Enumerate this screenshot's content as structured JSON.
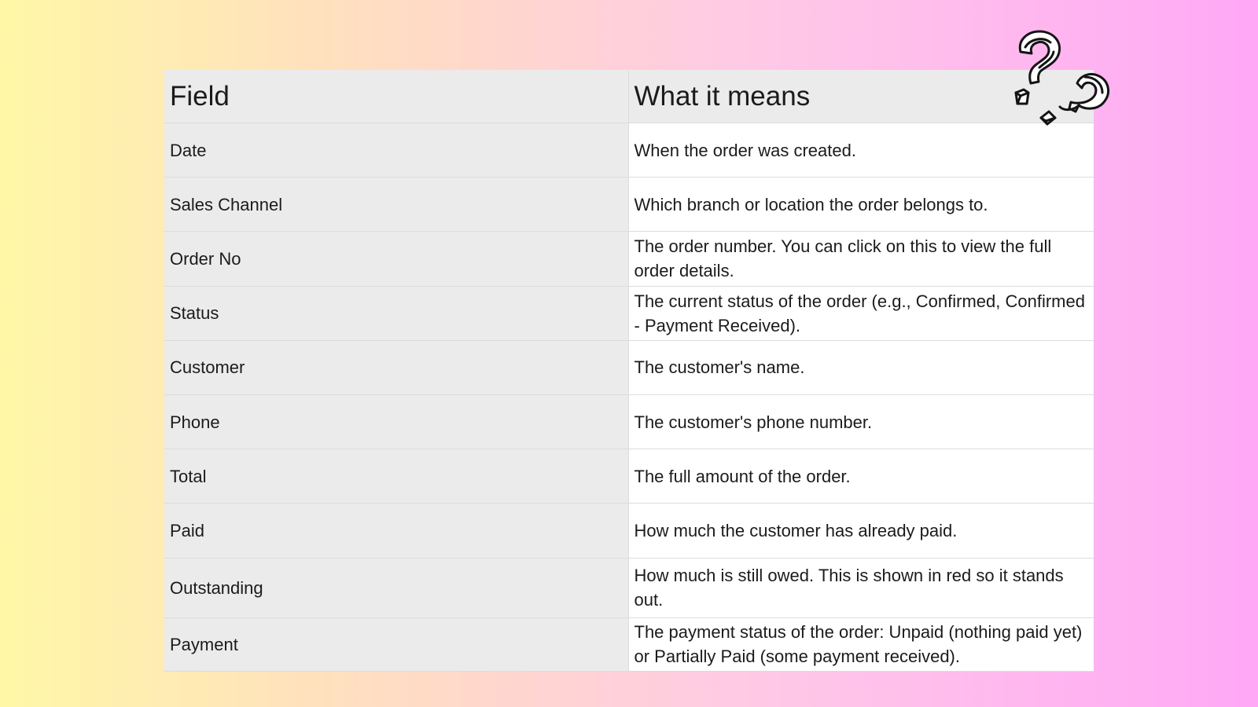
{
  "table": {
    "headers": {
      "field": "Field",
      "meaning": "What it means"
    },
    "rows": [
      {
        "field": "Date",
        "meaning": "When the order was created."
      },
      {
        "field": "Sales Channel",
        "meaning": "Which branch or location the order belongs to."
      },
      {
        "field": "Order No",
        "meaning": "The order number. You can click on this to view the full order details."
      },
      {
        "field": "Status",
        "meaning": "The current status of the order (e.g., Confirmed, Confirmed - Payment Received)."
      },
      {
        "field": "Customer",
        "meaning": "The customer's name."
      },
      {
        "field": "Phone",
        "meaning": "The customer's phone number."
      },
      {
        "field": "Total",
        "meaning": "The full amount of the order."
      },
      {
        "field": "Paid",
        "meaning": "How much the customer has already paid."
      },
      {
        "field": "Outstanding",
        "meaning": "How much is still owed. This is shown in red so it stands out."
      },
      {
        "field": "Payment",
        "meaning": "The payment status of the order: Unpaid (nothing paid yet) or Partially Paid (some payment received)."
      }
    ]
  },
  "decoration": {
    "icon": "question-marks-icon",
    "stroke_color": "#141414",
    "fill_color": "#ffffff"
  }
}
